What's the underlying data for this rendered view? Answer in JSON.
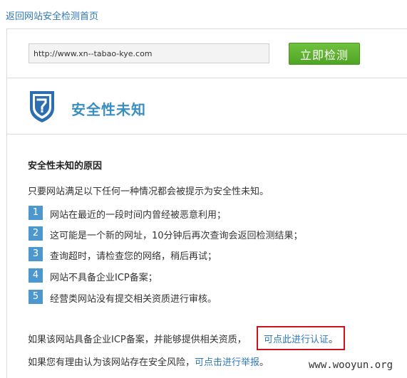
{
  "header": {
    "back_link": "返回网站安全检测首页"
  },
  "scan": {
    "url_value": "http://www.xn--tabao-kye.com",
    "button_label": "立即检测"
  },
  "status": {
    "title": "安全性未知"
  },
  "reasons": {
    "heading": "安全性未知的原因",
    "intro": "只要网站满足以下任何一种情况都会被提示为安全性未知。",
    "items": [
      {
        "num": "1",
        "text": "网站在最近的一段时间内曾经被恶意利用；"
      },
      {
        "num": "2",
        "text": "这可能是一个新的网址，10分钟后再次查询会返回检测结果；"
      },
      {
        "num": "3",
        "text": "查询超时，请检查您的网络，稍后再试；"
      },
      {
        "num": "4",
        "text": "网站不具备企业ICP备案；"
      },
      {
        "num": "5",
        "text": "经营类网站没有提交相关资质进行审核。"
      }
    ]
  },
  "footer": {
    "cert_text": "如果该网站具备企业ICP备案，并能够提供相关资质，",
    "cert_link": "可点此进行认证",
    "cert_end": "。",
    "report_text": "如果您有理由认为该网站存在安全风险，",
    "report_link": "可点击进行举报",
    "report_end": "。"
  },
  "watermark": "www.wooyun.org",
  "colors": {
    "link": "#2f78b8",
    "button_green": "#5bb22d",
    "shield_blue": "#2c6fb0",
    "badge_blue": "#4c97cd",
    "highlight_red": "#c8141e"
  }
}
